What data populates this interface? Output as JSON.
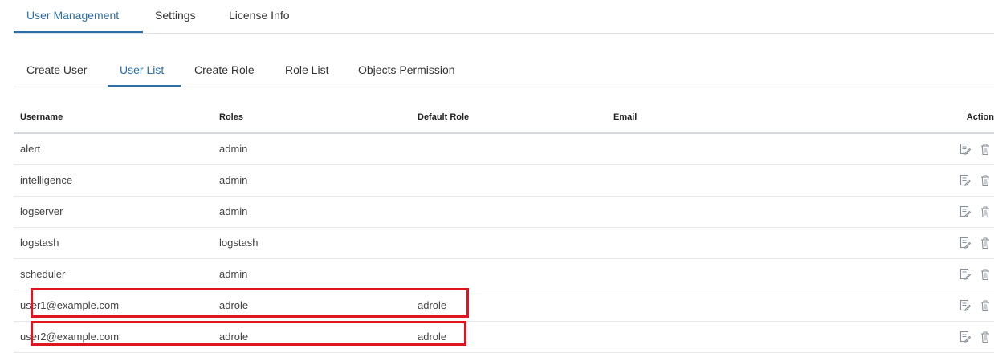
{
  "top_tabs": [
    {
      "label": "User Management",
      "active": true
    },
    {
      "label": "Settings",
      "active": false
    },
    {
      "label": "License Info",
      "active": false
    }
  ],
  "sub_tabs": [
    {
      "label": "Create User",
      "active": false
    },
    {
      "label": "User List",
      "active": true
    },
    {
      "label": "Create Role",
      "active": false
    },
    {
      "label": "Role List",
      "active": false
    },
    {
      "label": "Objects Permission",
      "active": false
    }
  ],
  "table": {
    "headers": {
      "username": "Username",
      "roles": "Roles",
      "default_role": "Default Role",
      "email": "Email",
      "action": "Action"
    },
    "rows": [
      {
        "username": "alert",
        "roles": "admin",
        "default_role": "",
        "email": ""
      },
      {
        "username": "intelligence",
        "roles": "admin",
        "default_role": "",
        "email": ""
      },
      {
        "username": "logserver",
        "roles": "admin",
        "default_role": "",
        "email": ""
      },
      {
        "username": "logstash",
        "roles": "logstash",
        "default_role": "",
        "email": ""
      },
      {
        "username": "scheduler",
        "roles": "admin",
        "default_role": "",
        "email": ""
      },
      {
        "username": "user1@example.com",
        "roles": "adrole",
        "default_role": "adrole",
        "email": ""
      },
      {
        "username": "user2@example.com",
        "roles": "adrole",
        "default_role": "adrole",
        "email": ""
      }
    ],
    "action_icons": [
      "edit-icon",
      "delete-icon"
    ]
  },
  "colors": {
    "accent": "#2c6fa8",
    "highlight": "#e01420"
  }
}
